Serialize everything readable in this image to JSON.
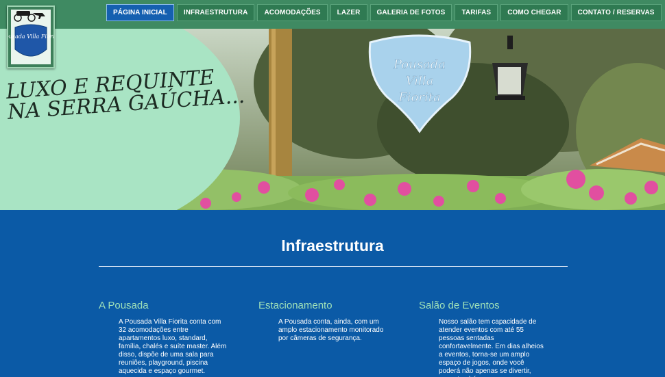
{
  "header": {
    "logo_text": "Pousada Villa Fiorita",
    "nav": [
      {
        "label": "PÁGINA INICIAL",
        "active": true
      },
      {
        "label": "INFRAESTRUTURA",
        "active": false
      },
      {
        "label": "ACOMODAÇÕES",
        "active": false
      },
      {
        "label": "LAZER",
        "active": false
      },
      {
        "label": "GALERIA DE FOTOS",
        "active": false
      },
      {
        "label": "TARIFAS",
        "active": false
      },
      {
        "label": "COMO CHEGAR",
        "active": false
      },
      {
        "label": "CONTATO / RESERVAS",
        "active": false
      }
    ]
  },
  "hero": {
    "slogan_line1": "LUXO E REQUINTE",
    "slogan_line2": "NA SERRA GAÚCHA...",
    "sign_text": "Pousada Villa Fiorita"
  },
  "main": {
    "title": "Infraestrutura",
    "columns": [
      {
        "heading": "A Pousada",
        "text": "A Pousada Villa Fiorita conta com 32 acomodações entre apartamentos luxo, standard, família, chalés e suíte master. Além disso, dispõe de uma sala para reuniões, playground, piscina aquecida e espaço gourmet."
      },
      {
        "heading": "Estacionamento",
        "text": "A Pousada conta, ainda, com um amplo estacionamento monitorado por câmeras de segurança."
      },
      {
        "heading": "Salão de Eventos",
        "text": "Nosso salão tem capacidade de atender eventos com até 55 pessoas sentadas confortavelmente. Em dias alheios a eventos, torna-se um amplo espaço de jogos, onde você poderá não apenas se divertir, como também"
      }
    ]
  },
  "colors": {
    "nav_bg": "#3f8a62",
    "nav_active": "#1560b0",
    "content_bg": "#0b5aa6",
    "heading_green": "#9ee0b8"
  }
}
